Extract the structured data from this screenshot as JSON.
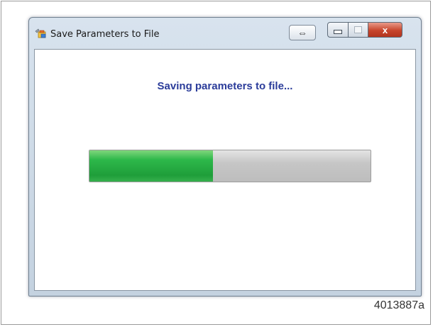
{
  "window": {
    "title": "Save Parameters to File",
    "icon": "parameters-app-icon",
    "swap_icon": "swap-arrows-icon",
    "close_label": "x"
  },
  "content": {
    "status_text": "Saving parameters to file...",
    "progress_fraction": 0.44,
    "progress_color": "#2db84a"
  },
  "figure": {
    "id": "4013887a"
  }
}
